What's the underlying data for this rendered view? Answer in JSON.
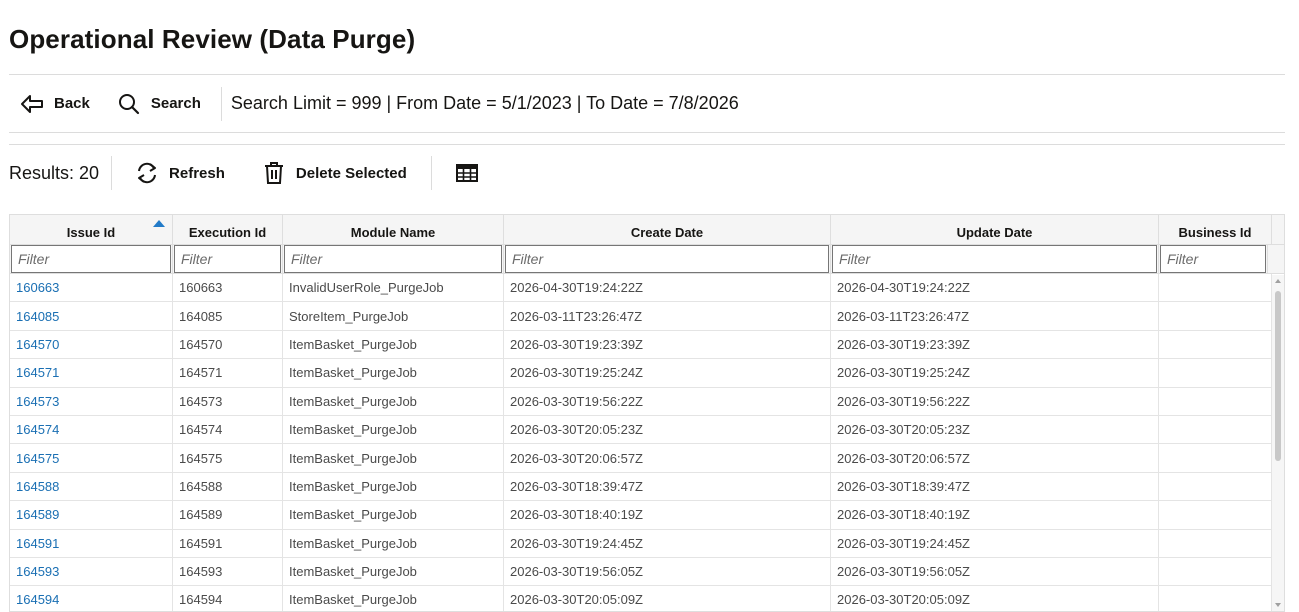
{
  "page": {
    "title": "Operational Review (Data Purge)"
  },
  "toolbar": {
    "back_label": "Back",
    "search_label": "Search",
    "search_summary": "Search Limit = 999 | From Date = 5/1/2023 | To Date = 7/8/2026"
  },
  "results_bar": {
    "results_text": "Results: 20",
    "refresh_label": "Refresh",
    "delete_label": "Delete Selected"
  },
  "table": {
    "columns": [
      "Issue Id",
      "Execution Id",
      "Module Name",
      "Create Date",
      "Update Date",
      "Business Id"
    ],
    "sorted_column": "Issue Id",
    "sort_direction": "ascending",
    "filter_placeholder": "Filter",
    "rows": [
      [
        "160663",
        "160663",
        "InvalidUserRole_PurgeJob",
        "2026-04-30T19:24:22Z",
        "2026-04-30T19:24:22Z",
        ""
      ],
      [
        "164085",
        "164085",
        "StoreItem_PurgeJob",
        "2026-03-11T23:26:47Z",
        "2026-03-11T23:26:47Z",
        ""
      ],
      [
        "164570",
        "164570",
        "ItemBasket_PurgeJob",
        "2026-03-30T19:23:39Z",
        "2026-03-30T19:23:39Z",
        ""
      ],
      [
        "164571",
        "164571",
        "ItemBasket_PurgeJob",
        "2026-03-30T19:25:24Z",
        "2026-03-30T19:25:24Z",
        ""
      ],
      [
        "164573",
        "164573",
        "ItemBasket_PurgeJob",
        "2026-03-30T19:56:22Z",
        "2026-03-30T19:56:22Z",
        ""
      ],
      [
        "164574",
        "164574",
        "ItemBasket_PurgeJob",
        "2026-03-30T20:05:23Z",
        "2026-03-30T20:05:23Z",
        ""
      ],
      [
        "164575",
        "164575",
        "ItemBasket_PurgeJob",
        "2026-03-30T20:06:57Z",
        "2026-03-30T20:06:57Z",
        ""
      ],
      [
        "164588",
        "164588",
        "ItemBasket_PurgeJob",
        "2026-03-30T18:39:47Z",
        "2026-03-30T18:39:47Z",
        ""
      ],
      [
        "164589",
        "164589",
        "ItemBasket_PurgeJob",
        "2026-03-30T18:40:19Z",
        "2026-03-30T18:40:19Z",
        ""
      ],
      [
        "164591",
        "164591",
        "ItemBasket_PurgeJob",
        "2026-03-30T19:24:45Z",
        "2026-03-30T19:24:45Z",
        ""
      ],
      [
        "164593",
        "164593",
        "ItemBasket_PurgeJob",
        "2026-03-30T19:56:05Z",
        "2026-03-30T19:56:05Z",
        ""
      ],
      [
        "164594",
        "164594",
        "ItemBasket_PurgeJob",
        "2026-03-30T20:05:09Z",
        "2026-03-30T20:05:09Z",
        ""
      ]
    ]
  },
  "colors": {
    "link": "#1a6fb3",
    "sort_indicator": "#227bc8",
    "text": "#161513"
  },
  "icons": {
    "back": "arrow-left-icon",
    "search": "magnifier-icon",
    "refresh": "refresh-icon",
    "delete": "trash-icon",
    "columns": "table-grid-icon"
  }
}
